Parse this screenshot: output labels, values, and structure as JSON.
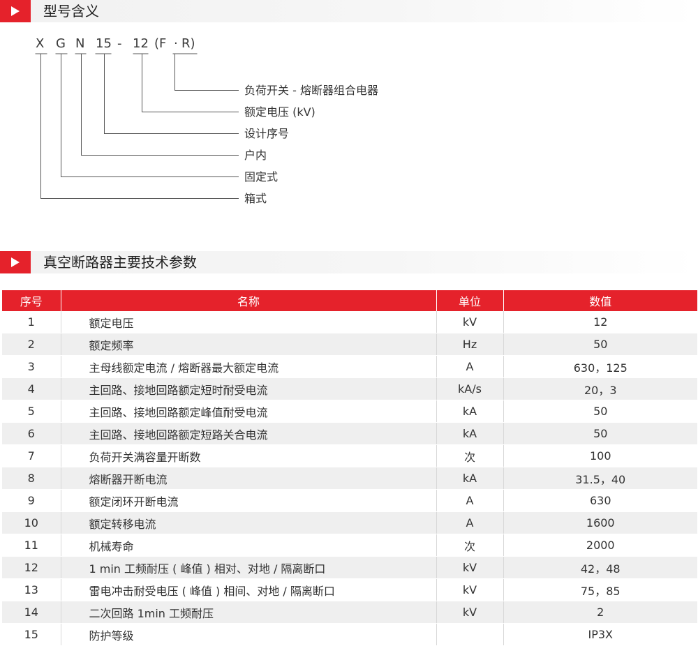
{
  "section1": {
    "title": "型号含义"
  },
  "section2": {
    "title": "真空断路器主要技术参数"
  },
  "model_code": {
    "chars": [
      "X",
      "G",
      "N",
      "15",
      "-",
      "12",
      "(F",
      "·",
      "R)"
    ],
    "meanings": [
      "负荷开关 - 熔断器组合电器",
      "额定电压 (kV)",
      "设计序号",
      "户内",
      "固定式",
      "箱式"
    ]
  },
  "table": {
    "headers": [
      "序号",
      "名称",
      "单位",
      "数值"
    ],
    "rows": [
      [
        "1",
        "额定电压",
        "kV",
        "12"
      ],
      [
        "2",
        "额定频率",
        "Hz",
        "50"
      ],
      [
        "3",
        "主母线额定电流 / 熔断器最大额定电流",
        "A",
        "630，125"
      ],
      [
        "4",
        "主回路、接地回路额定短时耐受电流",
        "kA/s",
        "20，3"
      ],
      [
        "5",
        "主回路、接地回路额定峰值耐受电流",
        "kA",
        "50"
      ],
      [
        "6",
        "主回路、接地回路额定短路关合电流",
        "kA",
        "50"
      ],
      [
        "7",
        "负荷开关满容量开断数",
        "次",
        "100"
      ],
      [
        "8",
        "熔断器开断电流",
        "kA",
        "31.5，40"
      ],
      [
        "9",
        "额定闭环开断电流",
        "A",
        "630"
      ],
      [
        "10",
        "额定转移电流",
        "A",
        "1600"
      ],
      [
        "11",
        "机械寿命",
        "次",
        "2000"
      ],
      [
        "12",
        "1 min 工频耐压 ( 峰值 ) 相对、对地 / 隔离断口",
        "kV",
        "42，48"
      ],
      [
        "13",
        "雷电冲击耐受电压 ( 峰值 ) 相间、对地 / 隔离断口",
        "kV",
        "75，85"
      ],
      [
        "14",
        "二次回路 1min 工频耐压",
        "kV",
        "2"
      ],
      [
        "15",
        "防护等级",
        "",
        "IP3X"
      ]
    ]
  },
  "colors": {
    "accent": "#e5222b",
    "row_alt": "#efefef",
    "line": "#555555"
  },
  "icons": {
    "section_marker": "play-triangle-icon"
  }
}
